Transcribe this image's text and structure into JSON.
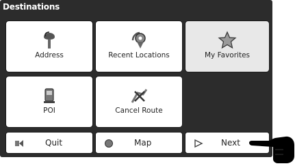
{
  "header": {
    "title": "Destinations"
  },
  "tiles": [
    {
      "label": "Address",
      "icon": "pushpin-icon"
    },
    {
      "label": "Recent Locations",
      "icon": "recent-locations-icon"
    },
    {
      "label": "My Favorites",
      "icon": "star-icon"
    },
    {
      "label": "POI",
      "icon": "poi-icon"
    },
    {
      "label": "Cancel Route",
      "icon": "cancel-route-icon"
    }
  ],
  "bottom_bar": {
    "quit_label": "Quit",
    "map_label": "Map",
    "next_label": "Next"
  }
}
